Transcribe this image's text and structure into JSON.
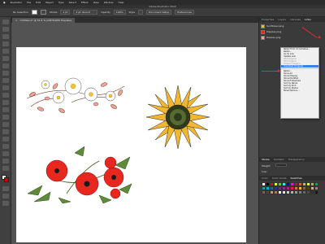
{
  "menubar": {
    "items": [
      "Illustrator",
      "File",
      "Edit",
      "Object",
      "Type",
      "Select",
      "Effect",
      "View",
      "Window",
      "Help"
    ]
  },
  "titlebar": {
    "title": "Adobe Illustrator 2022"
  },
  "controlbar": {
    "selection_label": "No Selection",
    "stroke_label": "Stroke",
    "stroke_weight": "1 pt",
    "brush_label": "3 pt. Round",
    "opacity_label": "Opacity",
    "opacity_value": "100%",
    "style_label": "Style",
    "doc_setup_label": "Document Setup",
    "preferences_label": "Preferences"
  },
  "document": {
    "tab_title": "Untitled-1* @ 51.5 % (CMYK/GPU Preview)"
  },
  "panels": {
    "top_tabs": [
      "Properties",
      "Layers",
      "Libraries",
      "Links"
    ],
    "links": [
      {
        "name": "Sunflower.png"
      },
      {
        "name": "Poppies.png"
      },
      {
        "name": "Daisies.png"
      }
    ],
    "context_menu": [
      {
        "label": "Relink from CC Libraries...",
        "state": "normal"
      },
      {
        "label": "Relink...",
        "state": "normal"
      },
      {
        "label": "Go To Link",
        "state": "normal"
      },
      {
        "label": "Update Link",
        "state": "normal"
      },
      {
        "label": "Edit Original",
        "state": "dim"
      },
      {
        "label": "Edit Original",
        "state": "dim"
      },
      {
        "label": "Embed Image(s)",
        "state": "dim"
      },
      {
        "label": "Unembed Image(s)",
        "state": "highlighted"
      },
      {
        "sep": true
      },
      {
        "label": "Relink...",
        "state": "normal"
      },
      {
        "label": "Show All",
        "state": "normal"
      },
      {
        "label": "Show Missing",
        "state": "normal"
      },
      {
        "label": "Show Modified",
        "state": "normal"
      },
      {
        "label": "Show Embedded",
        "state": "normal"
      },
      {
        "label": "Sort by Name",
        "state": "normal"
      },
      {
        "label": "Sort by Kind",
        "state": "normal"
      },
      {
        "label": "Sort by Status",
        "state": "normal"
      },
      {
        "label": "Panel Options...",
        "state": "normal"
      }
    ],
    "stroke_tabs": [
      "Stroke",
      "Gradient",
      "Transparency"
    ],
    "stroke": {
      "weight_label": "Weight:",
      "cap_label": "Cap:",
      "corner_label": "Corner:",
      "align_label": "Align Stroke:",
      "dashed_label": "Dashed Line"
    },
    "swatch_tabs": [
      "Color",
      "Color Guide",
      "Swatches"
    ],
    "swatch_colors": [
      "#ffffff",
      "#000000",
      "#ff0000",
      "#ffff00",
      "#00ff00",
      "#00ffff",
      "#0000ff",
      "#ff00ff",
      "#c41230",
      "#e8542f",
      "#f7a81b",
      "#fff200",
      "#8dc63f",
      "#00a651",
      "#00a99d",
      "#00aeef",
      "#0072bc",
      "#2e3192",
      "#662d91",
      "#92278f",
      "#ec008c",
      "#ed145b",
      "#f26522",
      "#fbaf3f",
      "#8c6239",
      "#603813",
      "#c7b299",
      "#998675",
      "#736357",
      "#534741",
      "#c69c6d",
      "#a67c52",
      "#ffffff",
      "#e6e6e6",
      "#cccccc",
      "#b3b3b3",
      "#999999",
      "#808080",
      "#666666",
      "#4d4d4d",
      "#333333",
      "#1a1a1a"
    ]
  }
}
